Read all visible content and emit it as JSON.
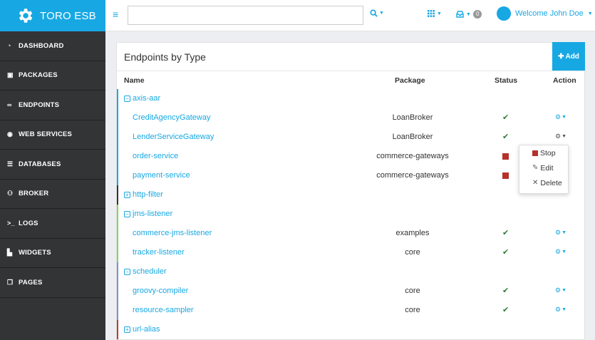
{
  "brand": {
    "name": "TORO ESB",
    "logo_icon": "gear-logo-icon",
    "color": "#17a8e3"
  },
  "search": {
    "placeholder": ""
  },
  "header": {
    "welcome": "Welcome John Doe",
    "notification_count": "0"
  },
  "sidebar": {
    "items": [
      {
        "label": "DASHBOARD",
        "icon": "tachometer-icon",
        "glyph": "◔"
      },
      {
        "label": "PACKAGES",
        "icon": "archive-icon",
        "glyph": "▣"
      },
      {
        "label": "ENDPOINTS",
        "icon": "link-icon",
        "glyph": "∞"
      },
      {
        "label": "WEB SERVICES",
        "icon": "circle-dot-icon",
        "glyph": "◉"
      },
      {
        "label": "DATABASES",
        "icon": "database-icon",
        "glyph": "☰"
      },
      {
        "label": "BROKER",
        "icon": "sitemap-icon",
        "glyph": "⚇"
      },
      {
        "label": "LOGS",
        "icon": "terminal-icon",
        "glyph": ">_"
      },
      {
        "label": "WIDGETS",
        "icon": "cubes-icon",
        "glyph": "▙"
      },
      {
        "label": "PAGES",
        "icon": "files-icon",
        "glyph": "❐"
      }
    ]
  },
  "panel": {
    "title": "Endpoints by Type",
    "add_label": "Add"
  },
  "table": {
    "headers": {
      "name": "Name",
      "package": "Package",
      "status": "Status",
      "action": "Action"
    }
  },
  "groups": [
    {
      "name": "axis-aar",
      "expanded": true,
      "color": "#17a8e3",
      "endpoints": [
        {
          "name": "CreditAgencyGateway",
          "package": "LoanBroker",
          "status": "running"
        },
        {
          "name": "LenderServiceGateway",
          "package": "LoanBroker",
          "status": "running"
        },
        {
          "name": "order-service",
          "package": "commerce-gateways",
          "status": "stopped"
        },
        {
          "name": "payment-service",
          "package": "commerce-gateways",
          "status": "stopped"
        }
      ]
    },
    {
      "name": "http-filter",
      "expanded": false,
      "color": "#333333",
      "endpoints": []
    },
    {
      "name": "jms-listener",
      "expanded": true,
      "color": "#7ed957",
      "endpoints": [
        {
          "name": "commerce-jms-listener",
          "package": "examples",
          "status": "running"
        },
        {
          "name": "tracker-listener",
          "package": "core",
          "status": "running"
        }
      ]
    },
    {
      "name": "scheduler",
      "expanded": true,
      "color": "#7b8ee0",
      "endpoints": [
        {
          "name": "groovy-compiler",
          "package": "core",
          "status": "running"
        },
        {
          "name": "resource-sampler",
          "package": "core",
          "status": "running"
        }
      ]
    },
    {
      "name": "url-alias",
      "expanded": false,
      "color": "#c0392b",
      "endpoints": []
    }
  ],
  "dropdown": {
    "items": [
      "Stop",
      "Edit",
      "Delete"
    ]
  },
  "colors": {
    "accent": "#17a8e3",
    "ok": "#2e7d32",
    "stopped": "#b5312a",
    "sidebar": "#333436"
  }
}
